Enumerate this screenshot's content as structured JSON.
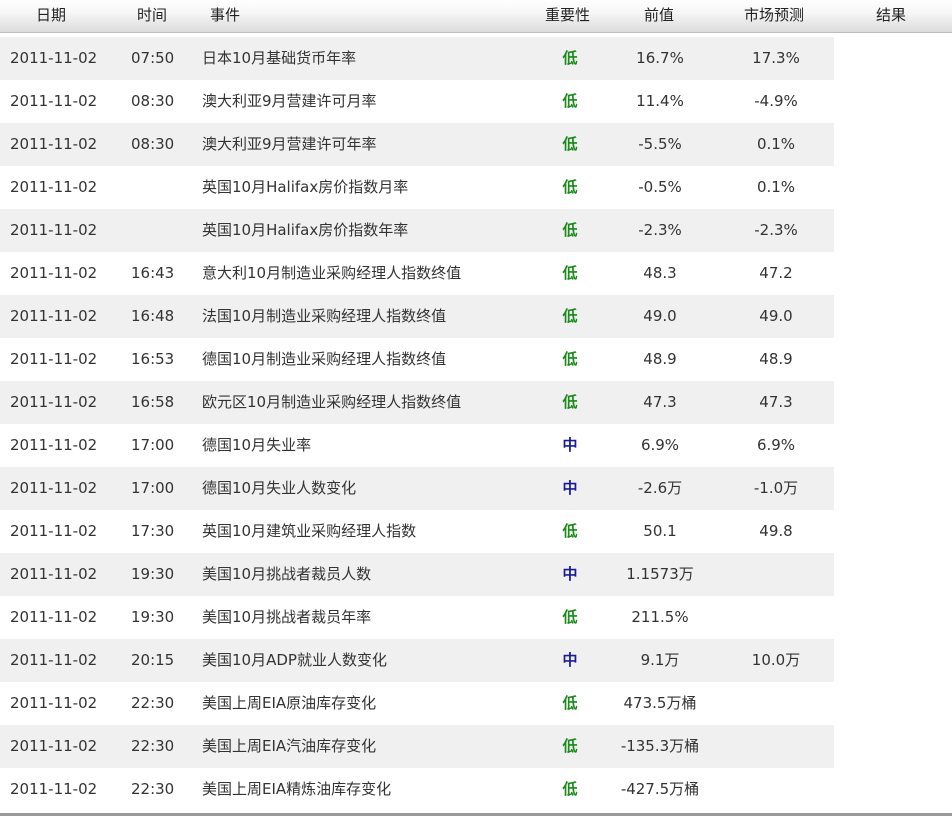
{
  "header": {
    "date": "日期",
    "time": "时间",
    "event": "事件",
    "importance": "重要性",
    "previous": "前值",
    "forecast": "市场预测",
    "result": "结果"
  },
  "colors": {
    "low": "#1a8a1a",
    "medium": "#1a1a9a",
    "alt_row": "#f0f0f0"
  },
  "rows": [
    {
      "date": "2011-11-02",
      "time": "07:50",
      "event": "日本10月基础货币年率",
      "importance": "低",
      "previous": "16.7%",
      "forecast": "17.3%",
      "result": ""
    },
    {
      "date": "2011-11-02",
      "time": "08:30",
      "event": "澳大利亚9月营建许可月率",
      "importance": "低",
      "previous": "11.4%",
      "forecast": "-4.9%",
      "result": ""
    },
    {
      "date": "2011-11-02",
      "time": "08:30",
      "event": "澳大利亚9月营建许可年率",
      "importance": "低",
      "previous": "-5.5%",
      "forecast": "0.1%",
      "result": ""
    },
    {
      "date": "2011-11-02",
      "time": "",
      "event": "英国10月Halifax房价指数月率",
      "importance": "低",
      "previous": "-0.5%",
      "forecast": "0.1%",
      "result": ""
    },
    {
      "date": "2011-11-02",
      "time": "",
      "event": "英国10月Halifax房价指数年率",
      "importance": "低",
      "previous": "-2.3%",
      "forecast": "-2.3%",
      "result": ""
    },
    {
      "date": "2011-11-02",
      "time": "16:43",
      "event": "意大利10月制造业采购经理人指数终值",
      "importance": "低",
      "previous": "48.3",
      "forecast": "47.2",
      "result": ""
    },
    {
      "date": "2011-11-02",
      "time": "16:48",
      "event": "法国10月制造业采购经理人指数终值",
      "importance": "低",
      "previous": "49.0",
      "forecast": "49.0",
      "result": ""
    },
    {
      "date": "2011-11-02",
      "time": "16:53",
      "event": "德国10月制造业采购经理人指数终值",
      "importance": "低",
      "previous": "48.9",
      "forecast": "48.9",
      "result": ""
    },
    {
      "date": "2011-11-02",
      "time": "16:58",
      "event": "欧元区10月制造业采购经理人指数终值",
      "importance": "低",
      "previous": "47.3",
      "forecast": "47.3",
      "result": ""
    },
    {
      "date": "2011-11-02",
      "time": "17:00",
      "event": "德国10月失业率",
      "importance": "中",
      "previous": "6.9%",
      "forecast": "6.9%",
      "result": ""
    },
    {
      "date": "2011-11-02",
      "time": "17:00",
      "event": "德国10月失业人数变化",
      "importance": "中",
      "previous": "-2.6万",
      "forecast": "-1.0万",
      "result": ""
    },
    {
      "date": "2011-11-02",
      "time": "17:30",
      "event": "英国10月建筑业采购经理人指数",
      "importance": "低",
      "previous": "50.1",
      "forecast": "49.8",
      "result": ""
    },
    {
      "date": "2011-11-02",
      "time": "19:30",
      "event": "美国10月挑战者裁员人数",
      "importance": "中",
      "previous": "1.1573万",
      "forecast": "",
      "result": ""
    },
    {
      "date": "2011-11-02",
      "time": "19:30",
      "event": "美国10月挑战者裁员年率",
      "importance": "低",
      "previous": "211.5%",
      "forecast": "",
      "result": ""
    },
    {
      "date": "2011-11-02",
      "time": "20:15",
      "event": "美国10月ADP就业人数变化",
      "importance": "中",
      "previous": "9.1万",
      "forecast": "10.0万",
      "result": ""
    },
    {
      "date": "2011-11-02",
      "time": "22:30",
      "event": "美国上周EIA原油库存变化",
      "importance": "低",
      "previous": "473.5万桶",
      "forecast": "",
      "result": ""
    },
    {
      "date": "2011-11-02",
      "time": "22:30",
      "event": "美国上周EIA汽油库存变化",
      "importance": "低",
      "previous": "-135.3万桶",
      "forecast": "",
      "result": ""
    },
    {
      "date": "2011-11-02",
      "time": "22:30",
      "event": "美国上周EIA精炼油库存变化",
      "importance": "低",
      "previous": "-427.5万桶",
      "forecast": "",
      "result": ""
    }
  ]
}
